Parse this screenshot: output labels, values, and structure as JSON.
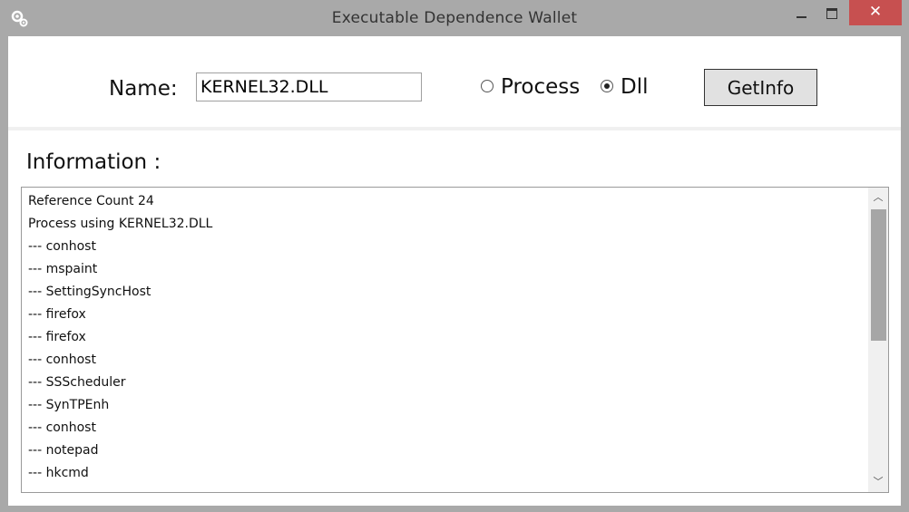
{
  "window": {
    "title": "Executable Dependence Wallet",
    "icon": "gears-icon",
    "controls": {
      "minimize": "minimize-icon",
      "maximize": "maximize-icon",
      "close_glyph": "✕"
    }
  },
  "form": {
    "name_label": "Name:",
    "name_value": "KERNEL32.DLL",
    "radio_process_label": "Process",
    "radio_dll_label": "Dll",
    "selected_radio": "Dll",
    "getinfo_label": "GetInfo"
  },
  "info": {
    "heading": "Information :",
    "lines": [
      "Reference Count 24",
      "Process using KERNEL32.DLL",
      "--- conhost",
      "--- mspaint",
      "--- SettingSyncHost",
      "--- firefox",
      "--- firefox",
      "--- conhost",
      "--- SSScheduler",
      "--- SynTPEnh",
      "--- conhost",
      "--- notepad",
      "--- hkcmd"
    ],
    "scrollbar": {
      "up_glyph": "︿",
      "down_glyph": "﹀",
      "scroll_position": 0.0
    }
  }
}
